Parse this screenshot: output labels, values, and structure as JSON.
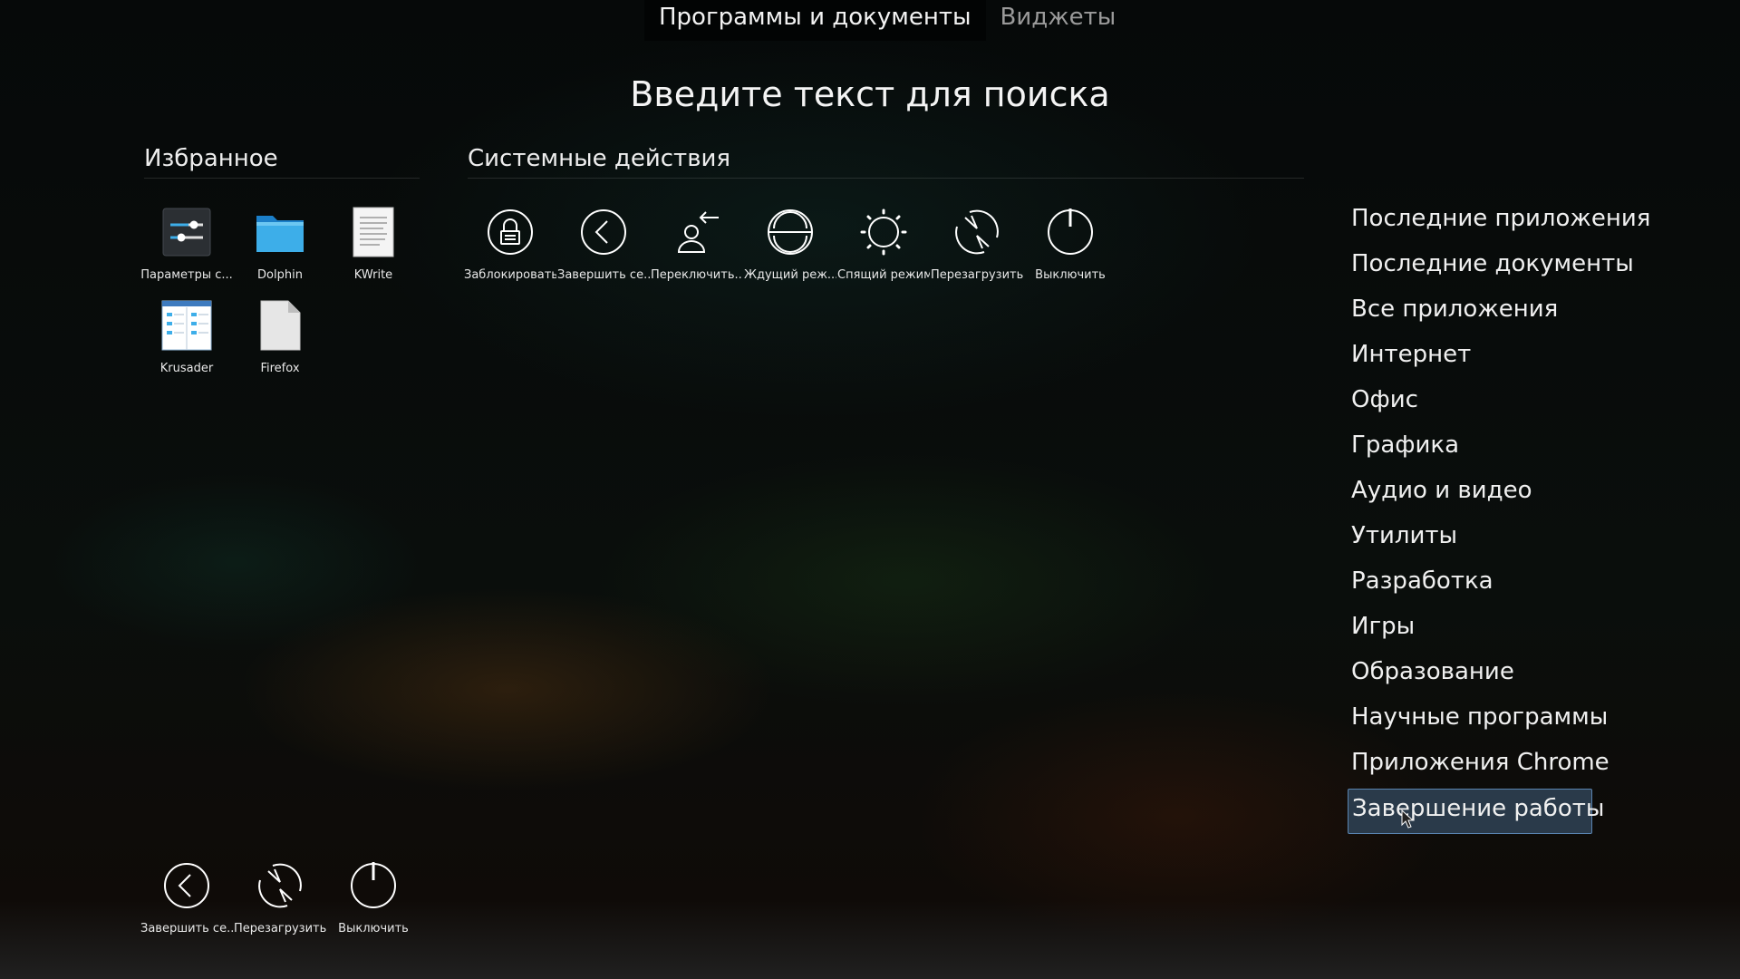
{
  "tabs": [
    "Программы и документы",
    "Виджеты"
  ],
  "search_prompt": "Введите текст для поиска",
  "favorites": {
    "title": "Избранное",
    "items": [
      {
        "label": "Параметры с...",
        "icon": "settings-sliders-icon"
      },
      {
        "label": "Dolphin",
        "icon": "folder-icon"
      },
      {
        "label": "KWrite",
        "icon": "text-document-icon"
      },
      {
        "label": "Krusader",
        "icon": "krusader-window-icon"
      },
      {
        "label": "Firefox",
        "icon": "blank-file-icon"
      }
    ]
  },
  "system_actions": {
    "title": "Системные действия",
    "items": [
      {
        "label": "Заблокировать",
        "icon": "lock-icon"
      },
      {
        "label": "Завершить се...",
        "icon": "logout-arrow-icon"
      },
      {
        "label": "Переключить...",
        "icon": "switch-user-icon"
      },
      {
        "label": "Ждущий реж...",
        "icon": "suspend-icon"
      },
      {
        "label": "Спящий режим",
        "icon": "hibernate-sun-icon"
      },
      {
        "label": "Перезагрузить",
        "icon": "restart-icon"
      },
      {
        "label": "Выключить",
        "icon": "power-icon"
      }
    ]
  },
  "bottom_actions": [
    {
      "label": "Завершить се...",
      "icon": "logout-arrow-icon"
    },
    {
      "label": "Перезагрузить",
      "icon": "restart-icon"
    },
    {
      "label": "Выключить",
      "icon": "power-icon"
    }
  ],
  "categories": [
    "Последние приложения",
    "Последние документы",
    "Все приложения",
    "Интернет",
    "Офис",
    "Графика",
    "Аудио и видео",
    "Утилиты",
    "Разработка",
    "Игры",
    "Образование",
    "Научные программы",
    "Приложения Chrome",
    "Завершение работы"
  ],
  "selected_category": "Завершение работы"
}
